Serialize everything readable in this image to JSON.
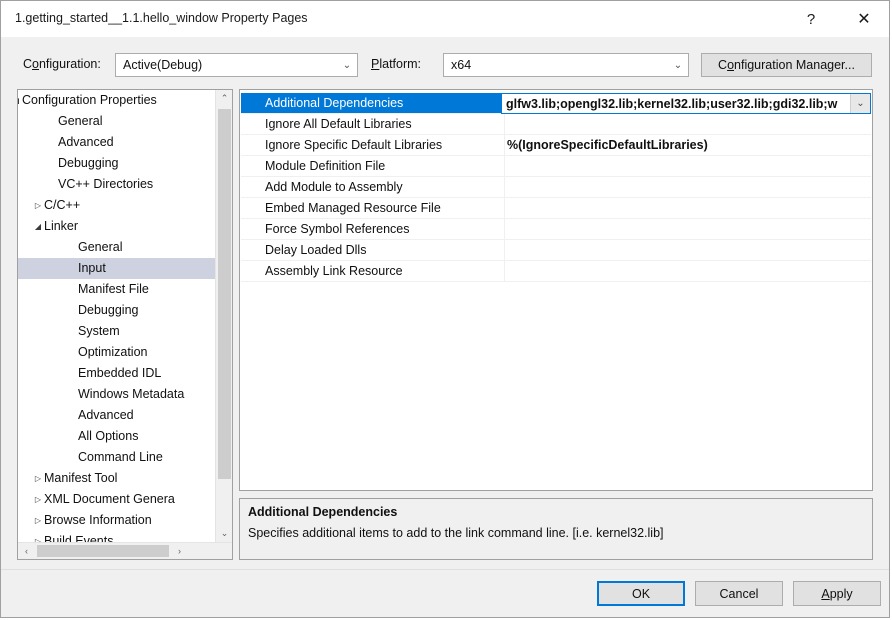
{
  "window": {
    "title": "1.getting_started__1.1.hello_window Property Pages",
    "help_glyph": "?",
    "close_glyph": "✕"
  },
  "toolbar": {
    "configuration_label_pre": "C",
    "configuration_label_accel": "o",
    "configuration_label_post": "nfiguration:",
    "configuration_value": "Active(Debug)",
    "platform_label_pre": "",
    "platform_label_accel": "P",
    "platform_label_post": "latform:",
    "platform_value": "x64",
    "config_manager_pre": "C",
    "config_manager_accel": "o",
    "config_manager_post": "nfiguration Manager...",
    "dropdown_glyph": "⌄"
  },
  "tree": {
    "nodes": [
      {
        "label": "Configuration Properties",
        "indent": 4,
        "glyph": "◢",
        "selected": false
      },
      {
        "label": "General",
        "indent": 40,
        "glyph": "",
        "selected": false
      },
      {
        "label": "Advanced",
        "indent": 40,
        "glyph": "",
        "selected": false
      },
      {
        "label": "Debugging",
        "indent": 40,
        "glyph": "",
        "selected": false
      },
      {
        "label": "VC++ Directories",
        "indent": 40,
        "glyph": "",
        "selected": false
      },
      {
        "label": "C/C++",
        "indent": 26,
        "glyph": "▷",
        "selected": false
      },
      {
        "label": "Linker",
        "indent": 26,
        "glyph": "◢",
        "selected": false
      },
      {
        "label": "General",
        "indent": 60,
        "glyph": "",
        "selected": false
      },
      {
        "label": "Input",
        "indent": 60,
        "glyph": "",
        "selected": true
      },
      {
        "label": "Manifest File",
        "indent": 60,
        "glyph": "",
        "selected": false
      },
      {
        "label": "Debugging",
        "indent": 60,
        "glyph": "",
        "selected": false
      },
      {
        "label": "System",
        "indent": 60,
        "glyph": "",
        "selected": false
      },
      {
        "label": "Optimization",
        "indent": 60,
        "glyph": "",
        "selected": false
      },
      {
        "label": "Embedded IDL",
        "indent": 60,
        "glyph": "",
        "selected": false
      },
      {
        "label": "Windows Metadata",
        "indent": 60,
        "glyph": "",
        "selected": false
      },
      {
        "label": "Advanced",
        "indent": 60,
        "glyph": "",
        "selected": false
      },
      {
        "label": "All Options",
        "indent": 60,
        "glyph": "",
        "selected": false
      },
      {
        "label": "Command Line",
        "indent": 60,
        "glyph": "",
        "selected": false
      },
      {
        "label": "Manifest Tool",
        "indent": 26,
        "glyph": "▷",
        "selected": false
      },
      {
        "label": "XML Document Genera",
        "indent": 26,
        "glyph": "▷",
        "selected": false
      },
      {
        "label": "Browse Information",
        "indent": 26,
        "glyph": "▷",
        "selected": false
      },
      {
        "label": "Build Events",
        "indent": 26,
        "glyph": "▷",
        "selected": false
      }
    ],
    "scroll_up_glyph": "⌃",
    "scroll_down_glyph": "⌄",
    "scroll_left_glyph": "‹",
    "scroll_right_glyph": "›"
  },
  "grid": {
    "rows": [
      {
        "name": "Additional Dependencies",
        "value": "",
        "selected": true,
        "editing": true
      },
      {
        "name": "Ignore All Default Libraries",
        "value": "",
        "selected": false,
        "editing": false
      },
      {
        "name": "Ignore Specific Default Libraries",
        "value": "%(IgnoreSpecificDefaultLibraries)",
        "selected": false,
        "editing": false
      },
      {
        "name": "Module Definition File",
        "value": "",
        "selected": false,
        "editing": false
      },
      {
        "name": "Add Module to Assembly",
        "value": "",
        "selected": false,
        "editing": false
      },
      {
        "name": "Embed Managed Resource File",
        "value": "",
        "selected": false,
        "editing": false
      },
      {
        "name": "Force Symbol References",
        "value": "",
        "selected": false,
        "editing": false
      },
      {
        "name": "Delay Loaded Dlls",
        "value": "",
        "selected": false,
        "editing": false
      },
      {
        "name": "Assembly Link Resource",
        "value": "",
        "selected": false,
        "editing": false
      }
    ],
    "editing_value": "glfw3.lib;opengl32.lib;kernel32.lib;user32.lib;gdi32.lib;w",
    "editing_dropdown_glyph": "⌄"
  },
  "description": {
    "title": "Additional Dependencies",
    "body": "Specifies additional items to add to the link command line. [i.e. kernel32.lib]"
  },
  "buttons": {
    "ok": "OK",
    "cancel": "Cancel",
    "apply_accel": "A",
    "apply_rest": "pply"
  }
}
